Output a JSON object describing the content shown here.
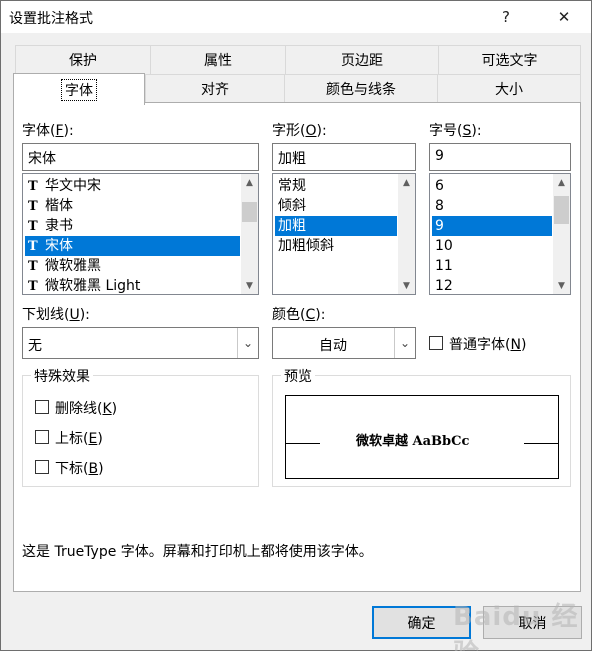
{
  "window": {
    "title": "设置批注格式",
    "help": "?",
    "close": "✕"
  },
  "tabs_back": [
    "保护",
    "属性",
    "页边距",
    "可选文字"
  ],
  "tabs_front": [
    "字体",
    "对齐",
    "颜色与线条",
    "大小"
  ],
  "font": {
    "label": "字体(",
    "accel": "F",
    "label_end": "):",
    "value": "宋体",
    "items": [
      "华文中宋",
      "楷体",
      "隶书",
      "宋体",
      "微软雅黑",
      "微软雅黑 Light"
    ],
    "selected_index": 3
  },
  "style": {
    "label": "字形(",
    "accel": "O",
    "label_end": "):",
    "value": "加粗",
    "items": [
      "常规",
      "倾斜",
      "加粗",
      "加粗倾斜"
    ],
    "selected_index": 2
  },
  "size": {
    "label": "字号(",
    "accel": "S",
    "label_end": "):",
    "value": "9",
    "items": [
      "6",
      "8",
      "9",
      "10",
      "11",
      "12"
    ],
    "selected_index": 2
  },
  "underline": {
    "label": "下划线(",
    "accel": "U",
    "label_end": "):",
    "value": "无"
  },
  "color": {
    "label": "颜色(",
    "accel": "C",
    "label_end": "):",
    "value": "自动"
  },
  "normal_font": {
    "label": "普通字体(",
    "accel": "N",
    "label_end": ")",
    "checked": false
  },
  "effects": {
    "title": "特殊效果",
    "strikethrough": {
      "label": "删除线(",
      "accel": "K",
      "label_end": ")",
      "checked": false
    },
    "superscript": {
      "label": "上标(",
      "accel": "E",
      "label_end": ")",
      "checked": false
    },
    "subscript": {
      "label": "下标(",
      "accel": "B",
      "label_end": ")",
      "checked": false
    }
  },
  "preview": {
    "title": "预览",
    "sample": "微软卓越  AaBbCc"
  },
  "info": "这是 TrueType 字体。屏幕和打印机上都将使用该字体。",
  "buttons": {
    "ok": "确定",
    "cancel": "取消"
  },
  "watermark": "Baidu 经验"
}
